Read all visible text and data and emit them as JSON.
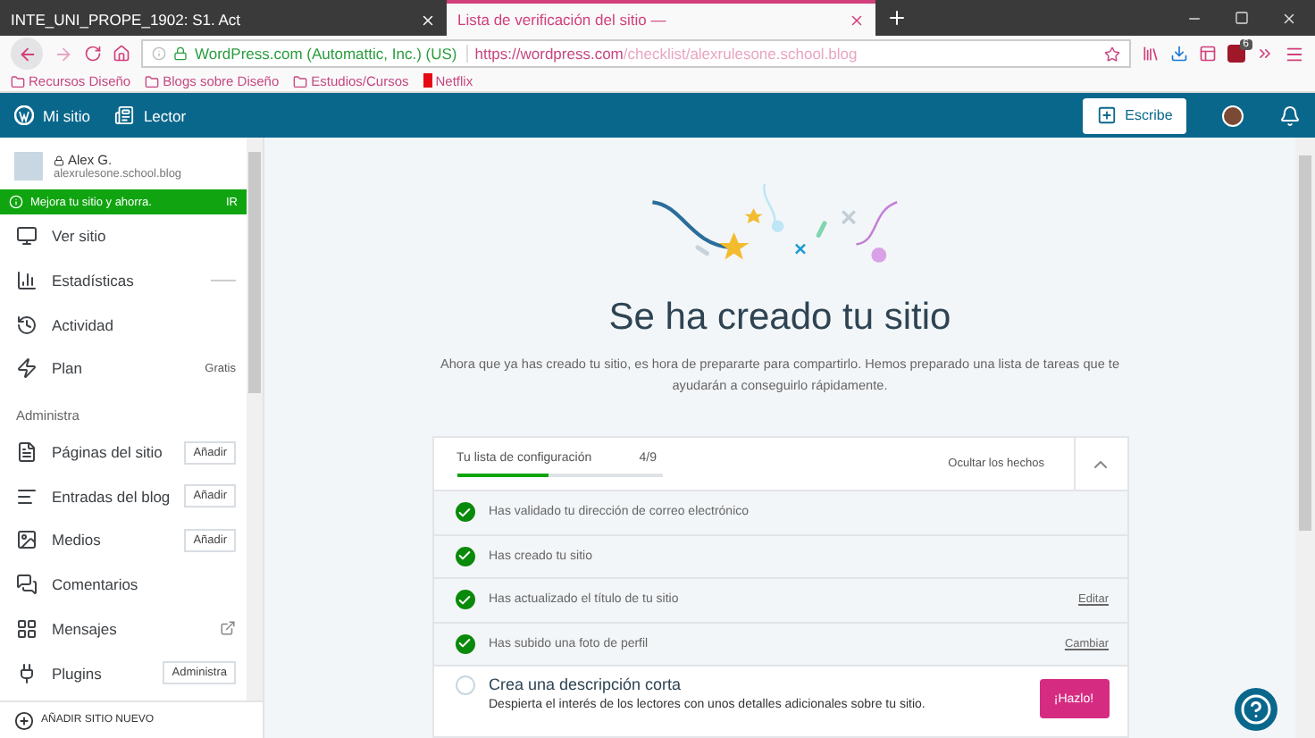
{
  "browser": {
    "tabs": [
      {
        "title": "INTE_UNI_PROPE_1902: S1. Act",
        "selected": false
      },
      {
        "title": "Lista de verificación del sitio —",
        "selected": true
      }
    ],
    "identity": "WordPress.com (Automattic, Inc.) (US)",
    "url_host": "https://wordpress.com",
    "url_path": "/checklist/alexrulesone.school.blog",
    "addon_badge": "6",
    "bookmarks": [
      "Recursos Diseño",
      "Blogs sobre Diseño",
      "Estudios/Cursos",
      "Netflix"
    ]
  },
  "masterbar": {
    "my_site": "Mi sitio",
    "reader": "Lector",
    "write": "Escribe"
  },
  "sidebar": {
    "site_name": "Alex G.",
    "site_url": "alexrulesone.school.blog",
    "banner": {
      "text": "Mejora tu sitio y ahorra.",
      "action": "IR"
    },
    "items": [
      {
        "kind": "plain",
        "label": "Ver sitio"
      },
      {
        "kind": "stats",
        "label": "Estadísticas"
      },
      {
        "kind": "plain",
        "label": "Actividad"
      },
      {
        "kind": "badge",
        "label": "Plan",
        "badge": "Gratis"
      },
      {
        "kind": "heading",
        "label": "Administra"
      },
      {
        "kind": "button",
        "label": "Páginas del sitio",
        "button": "Añadir"
      },
      {
        "kind": "button",
        "label": "Entradas del blog",
        "button": "Añadir"
      },
      {
        "kind": "button",
        "label": "Medios",
        "button": "Añadir"
      },
      {
        "kind": "plain",
        "label": "Comentarios"
      },
      {
        "kind": "external",
        "label": "Mensajes"
      },
      {
        "kind": "button",
        "label": "Plugins",
        "button": "Administra"
      }
    ],
    "footer": "AÑADIR SITIO NUEVO"
  },
  "main": {
    "title": "Se ha creado tu sitio",
    "description": "Ahora que ya has creado tu sitio, es hora de prepararte para compartirlo. Hemos preparado una lista de tareas que te ayudarán a conseguirlo rápidamente.",
    "checklist": {
      "title": "Tu lista de configuración",
      "count": "4/9",
      "level": 0.444,
      "toggle": "Ocultar los hechos",
      "expanded": true,
      "tasks": [
        {
          "title": "Has validado tu dirección de correo electrónico",
          "completed": true
        },
        {
          "title": "Has creado tu sitio",
          "completed": true
        },
        {
          "title": "Has actualizado el título de tu sitio",
          "completed": true,
          "action": "Editar"
        },
        {
          "title": "Has subido una foto de perfil",
          "completed": true,
          "action": "Cambiar"
        },
        {
          "title": "Crea una descripción corta",
          "completed": false,
          "description": "Despierta el interés de los lectores con unos detalles adicionales sobre tu sitio.",
          "action": "¡Hazlo!"
        }
      ]
    }
  }
}
